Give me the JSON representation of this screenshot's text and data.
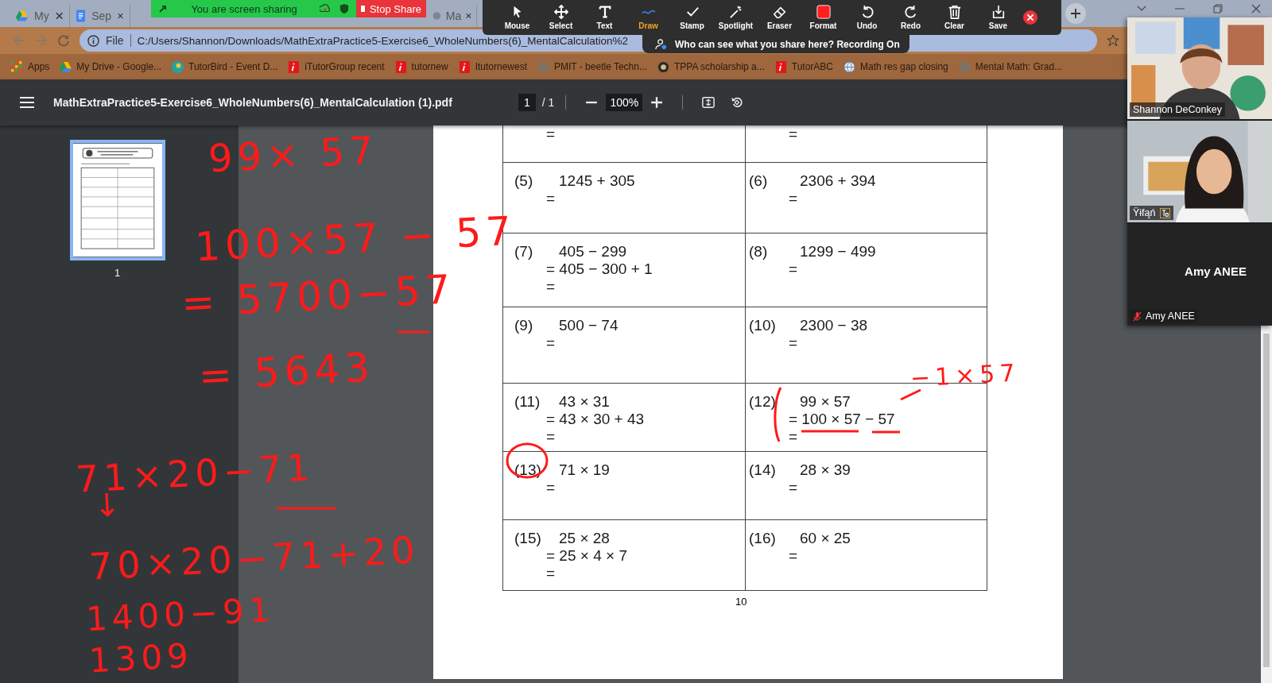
{
  "browser": {
    "tabs": [
      {
        "label": "My"
      },
      {
        "label": "Sep"
      },
      {
        "label": "Ma"
      }
    ],
    "address": {
      "scheme": "File",
      "url": "C:/Users/Shannon/Downloads/MathExtraPractice5-Exercise6_WholeNumbers(6)_MentalCalculation%2"
    },
    "bookmarks": [
      {
        "label": "Apps",
        "kind": "apps"
      },
      {
        "label": "My Drive - Google...",
        "kind": "drive"
      },
      {
        "label": "TutorBird - Event D...",
        "kind": "bird"
      },
      {
        "label": "iTutorGroup recent",
        "kind": "itutor"
      },
      {
        "label": "tutornew",
        "kind": "itutor"
      },
      {
        "label": "Itutornewest",
        "kind": "itutor"
      },
      {
        "label": "PMIT - beetle Techn...",
        "kind": "globe"
      },
      {
        "label": "TPPA scholarship a...",
        "kind": "crest"
      },
      {
        "label": "TutorABC",
        "kind": "itutor"
      },
      {
        "label": "Math res gap closing",
        "kind": "earth"
      },
      {
        "label": "Mental Math: Grad...",
        "kind": "globe"
      }
    ]
  },
  "share_banner": {
    "status": "You are screen sharing",
    "stop": "Stop Share"
  },
  "annotate_toolbar": {
    "tools": [
      {
        "label": "Mouse",
        "kind": "mouse",
        "selected": false
      },
      {
        "label": "Select",
        "kind": "select",
        "selected": false
      },
      {
        "label": "Text",
        "kind": "text",
        "selected": false
      },
      {
        "label": "Draw",
        "kind": "draw",
        "selected": true
      },
      {
        "label": "Stamp",
        "kind": "stamp",
        "selected": false
      },
      {
        "label": "Spotlight",
        "kind": "spotlight",
        "selected": false
      },
      {
        "label": "Eraser",
        "kind": "eraser",
        "selected": false
      },
      {
        "label": "Format",
        "kind": "format",
        "selected": false
      },
      {
        "label": "Undo",
        "kind": "undo",
        "selected": false
      },
      {
        "label": "Redo",
        "kind": "redo",
        "selected": false
      },
      {
        "label": "Clear",
        "kind": "clear",
        "selected": false
      },
      {
        "label": "Save",
        "kind": "save",
        "selected": false
      }
    ],
    "notice": "Who can see what you share here? Recording On"
  },
  "pdf_viewer": {
    "title": "MathExtraPractice5-Exercise6_WholeNumbers(6)_MentalCalculation (1).pdf",
    "page": "1",
    "page_of": "/ 1",
    "zoom": "100%",
    "thumbnail_label": "1"
  },
  "worksheet": {
    "rows": [
      [
        {
          "steps": [
            "="
          ]
        },
        {
          "steps": [
            "="
          ]
        }
      ],
      [
        {
          "number": "(5)",
          "expression": "1245 + 305",
          "steps": [
            "="
          ]
        },
        {
          "number": "(6)",
          "expression": "2306 + 394",
          "steps": [
            "="
          ]
        }
      ],
      [
        {
          "number": "(7)",
          "expression": "405 − 299",
          "steps": [
            "= 405 − 300 + 1",
            "="
          ]
        },
        {
          "number": "(8)",
          "expression": "1299 − 499",
          "steps": [
            "="
          ]
        }
      ],
      [
        {
          "number": "(9)",
          "expression": "500 − 74",
          "steps": [
            "="
          ]
        },
        {
          "number": "(10)",
          "expression": "2300 − 38",
          "steps": [
            "="
          ]
        }
      ],
      [
        {
          "number": "(11)",
          "expression": "43 × 31",
          "steps": [
            "= 43 × 30 + 43",
            "="
          ]
        },
        {
          "number": "(12)",
          "expression": "99 × 57",
          "steps": [
            "= 100 × 57 − 57",
            "="
          ]
        }
      ],
      [
        {
          "number": "(13)",
          "expression": "71 × 19",
          "steps": [
            "="
          ]
        },
        {
          "number": "(14)",
          "expression": "28 × 39",
          "steps": [
            "="
          ]
        }
      ],
      [
        {
          "number": "(15)",
          "expression": "25 × 28",
          "steps": [
            "= 25 × 4 × 7",
            "="
          ]
        },
        {
          "number": "(16)",
          "expression": "60 × 25",
          "steps": [
            "="
          ]
        }
      ]
    ],
    "page_number": "10"
  },
  "handwriting": {
    "side_notes": [
      "99× 57",
      "100×57 − 57",
      "= 5700−57",
      "= 5643",
      "71×20−71",
      "↓",
      "70×20−71+20",
      "1400−91",
      "1309"
    ],
    "page_notes": [
      "−1×57"
    ]
  },
  "participants": [
    {
      "name": "Shannon DeConkey",
      "kind": "video"
    },
    {
      "name": "Ÿɨfąń",
      "kind": "video"
    },
    {
      "name": "Amy ANEE",
      "display_name": "Amy ANEE",
      "kind": "audio",
      "muted": true
    }
  ]
}
